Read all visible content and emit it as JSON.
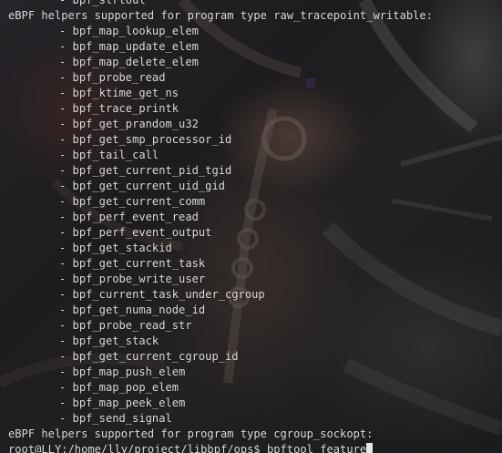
{
  "terminal": {
    "colors": {
      "text": "#dcdcdc",
      "background": "#1e1c1e",
      "cursor": "#e6e6e6"
    },
    "first_line": "- bpf_strtoul",
    "header_1": "eBPF helpers supported for program type raw_tracepoint_writable:",
    "helpers": [
      "- bpf_map_lookup_elem",
      "- bpf_map_update_elem",
      "- bpf_map_delete_elem",
      "- bpf_probe_read",
      "- bpf_ktime_get_ns",
      "- bpf_trace_printk",
      "- bpf_get_prandom_u32",
      "- bpf_get_smp_processor_id",
      "- bpf_tail_call",
      "- bpf_get_current_pid_tgid",
      "- bpf_get_current_uid_gid",
      "- bpf_get_current_comm",
      "- bpf_perf_event_read",
      "- bpf_perf_event_output",
      "- bpf_get_stackid",
      "- bpf_get_current_task",
      "- bpf_probe_write_user",
      "- bpf_current_task_under_cgroup",
      "- bpf_get_numa_node_id",
      "- bpf_probe_read_str",
      "- bpf_get_stack",
      "- bpf_get_current_cgroup_id",
      "- bpf_map_push_elem",
      "- bpf_map_pop_elem",
      "- bpf_map_peek_elem",
      "- bpf_send_signal"
    ],
    "header_2": "eBPF helpers supported for program type cgroup_sockopt:",
    "prompt_line": "root@LLY:/home/lly/project/libbpf/ops$ bpftool feature"
  }
}
